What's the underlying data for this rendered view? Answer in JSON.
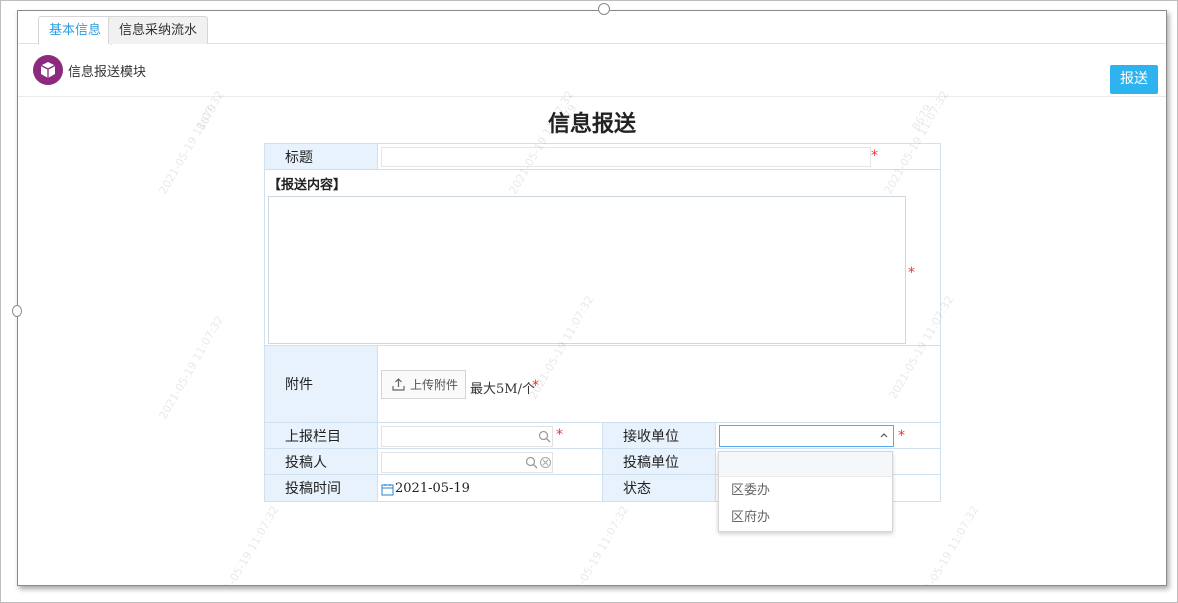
{
  "tabs": [
    {
      "label": "基本信息",
      "active": true
    },
    {
      "label": "信息采纳流水",
      "active": false
    }
  ],
  "module": {
    "title": "信息报送模块",
    "icon": "cube-icon",
    "icon_color": "#8c2a7e"
  },
  "actions": {
    "report_label": "报送",
    "report_color": "#2db3ed"
  },
  "page_title": "信息报送",
  "form": {
    "title_label": "标题",
    "title_value": "",
    "content_label": "【报送内容】",
    "content_value": "",
    "attachment_label": "附件",
    "upload_label": "上传附件",
    "attachment_hint": "最大5M/个",
    "column_label": "上报栏目",
    "column_value": "",
    "receiver_label": "接收单位",
    "receiver_value": "",
    "submitter_label": "投稿人",
    "submitter_value": "",
    "submitter_unit_label": "投稿单位",
    "submit_time_label": "投稿时间",
    "submit_time_value": "2021-05-19",
    "status_label": "状态",
    "required_mark": "*"
  },
  "receiver_dropdown": {
    "options": [
      "",
      "区委办",
      "区府办"
    ]
  },
  "watermark": {
    "text": "2021-05-19 11:07:32",
    "id_text": "8679"
  }
}
